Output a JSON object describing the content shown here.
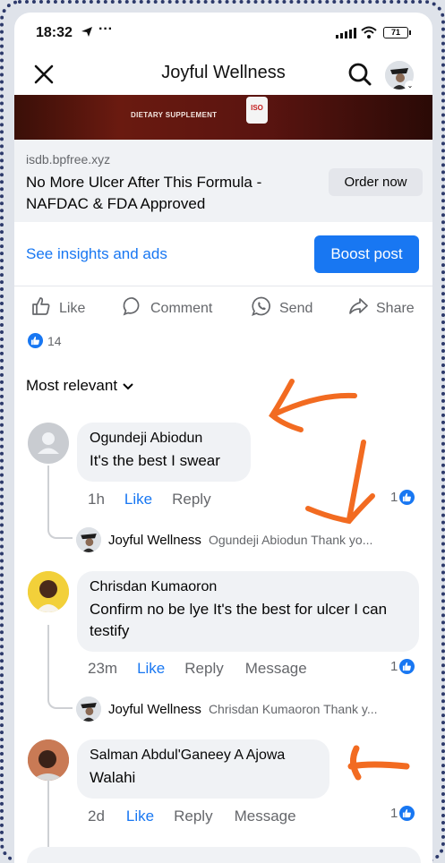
{
  "status_bar": {
    "time": "18:32",
    "more": "···",
    "battery": "71"
  },
  "header": {
    "title": "Joyful Wellness"
  },
  "product_image": {
    "label": "DIETARY SUPPLEMENT",
    "badge": "ISO"
  },
  "link_card": {
    "domain": "isdb.bpfree.xyz",
    "title": "No More Ulcer After This Formula - NAFDAC & FDA Approved",
    "cta": "Order now"
  },
  "insights": {
    "link": "See insights and ads",
    "boost": "Boost post"
  },
  "actions": {
    "like": "Like",
    "comment": "Comment",
    "send": "Send",
    "share": "Share"
  },
  "reactions": {
    "count": "14"
  },
  "sort": {
    "label": "Most relevant"
  },
  "comments": [
    {
      "name": "Ogundeji Abiodun",
      "text": "It's the best I swear",
      "time": "1h",
      "like": "Like",
      "reply": "Reply",
      "message": "",
      "likes": "1",
      "reply_preview": {
        "name": "Joyful Wellness",
        "text": "Ogundeji Abiodun Thank yo..."
      }
    },
    {
      "name": "Chrisdan Kumaoron",
      "text": "Confirm no be lye It's the best for ulcer I can testify",
      "time": "23m",
      "like": "Like",
      "reply": "Reply",
      "message": "Message",
      "likes": "1",
      "reply_preview": {
        "name": "Joyful Wellness",
        "text": "Chrisdan Kumaoron Thank y..."
      }
    },
    {
      "name": "Salman Abdul'Ganeey A Ajowa",
      "text": "Walahi",
      "time": "2d",
      "like": "Like",
      "reply": "Reply",
      "message": "Message",
      "likes": "1"
    }
  ],
  "colors": {
    "accent": "#1877f2",
    "annotation": "#f26b21",
    "bubble": "#f0f2f5"
  }
}
